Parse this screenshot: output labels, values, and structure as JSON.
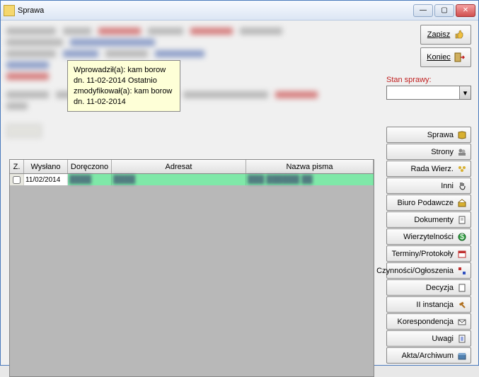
{
  "window": {
    "title": "Sprawa"
  },
  "buttons": {
    "zapisz": "Zapisz",
    "koniec": "Koniec"
  },
  "stan": {
    "label": "Stan sprawy:",
    "value": ""
  },
  "tooltip": {
    "line1": "Wprowadził(a): kam borow",
    "line2": "dn. 11-02-2014    Ostatnio",
    "line3": "zmodyfikował(a): kam borow",
    "line4": "dn. 11-02-2014"
  },
  "side": {
    "items": [
      {
        "label": "Sprawa"
      },
      {
        "label": "Strony"
      },
      {
        "label": "Rada Wierz."
      },
      {
        "label": "Inni"
      },
      {
        "label": "Biuro Podawcze"
      },
      {
        "label": "Dokumenty"
      },
      {
        "label": "Wierzytelności"
      },
      {
        "label": "Terminy/Protokoły"
      },
      {
        "label": "Czynności/Ogłoszenia"
      },
      {
        "label": "Decyzja"
      },
      {
        "label": "II instancja"
      },
      {
        "label": "Korespondencja"
      },
      {
        "label": "Uwagi"
      },
      {
        "label": "Akta/Archiwum"
      }
    ]
  },
  "grid": {
    "headers": {
      "z": "Z.",
      "wyslano": "Wysłano",
      "doreczono": "Doręczono",
      "adresat": "Adresat",
      "nazwa": "Nazwa pisma"
    },
    "rows": [
      {
        "z": false,
        "wyslano": "11/02/2014",
        "doreczono": "",
        "adresat": "",
        "nazwa": ""
      }
    ]
  },
  "colors": {
    "highlight_row": "#7fe8a8",
    "tooltip_bg": "#feffd7",
    "stan_label": "#c02020"
  }
}
